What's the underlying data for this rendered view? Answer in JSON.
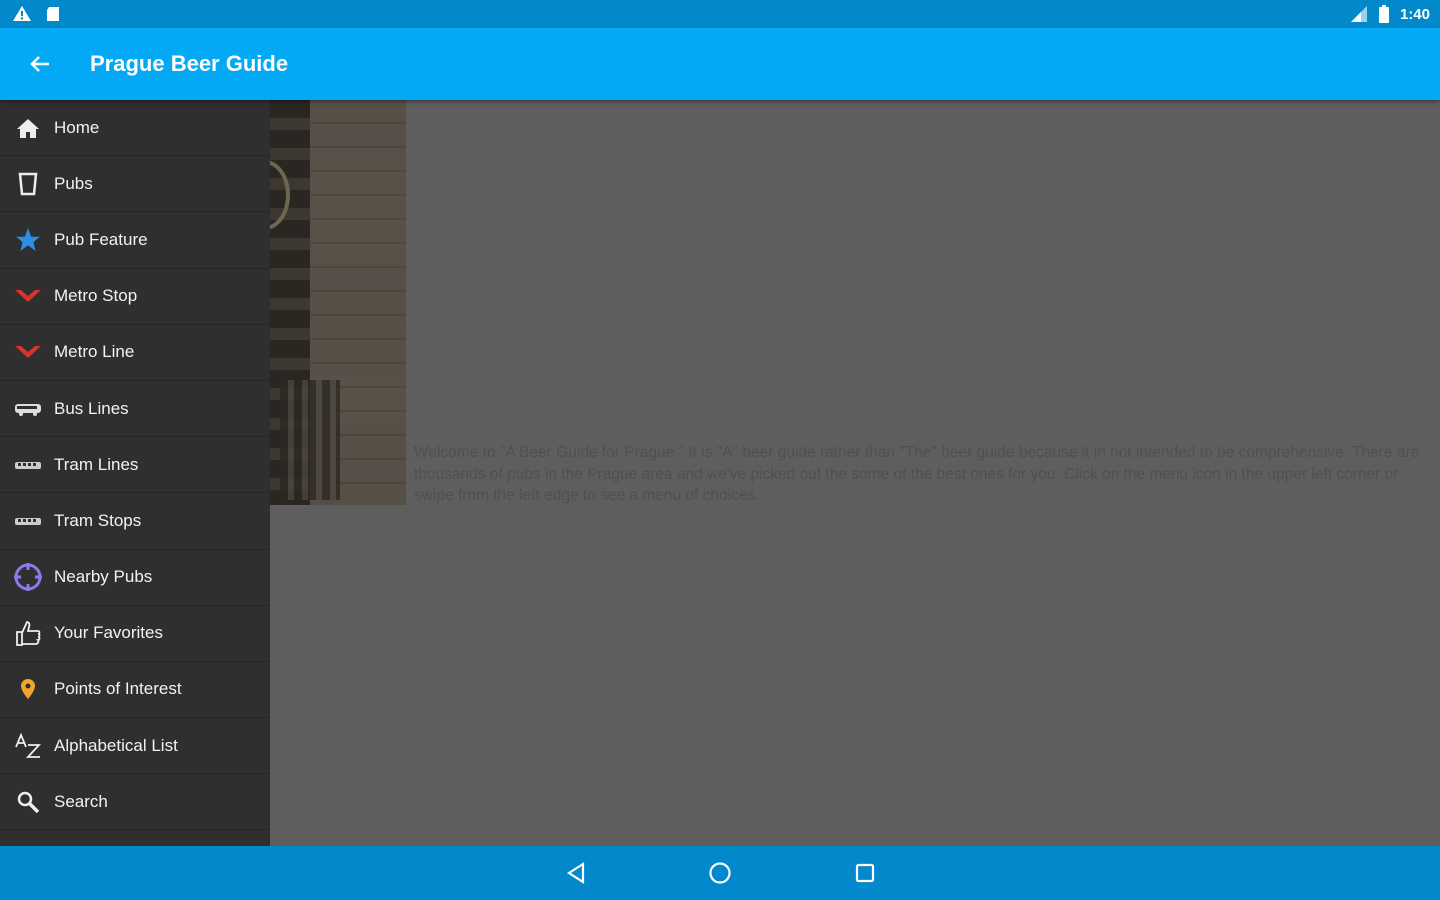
{
  "status_bar": {
    "time": "1:40",
    "icons": [
      "warning-icon",
      "sd-card-icon",
      "signal-icon",
      "battery-icon"
    ]
  },
  "app_bar": {
    "title": "Prague Beer Guide",
    "back_icon": "arrow-left-icon",
    "color": "#03a9f4"
  },
  "drawer": {
    "items": [
      {
        "label": "Home",
        "icon": "home-icon"
      },
      {
        "label": "Pubs",
        "icon": "beer-glass-icon"
      },
      {
        "label": "Pub Feature",
        "icon": "star-icon"
      },
      {
        "label": "Metro Stop",
        "icon": "metro-stop-icon"
      },
      {
        "label": "Metro Line",
        "icon": "metro-line-icon"
      },
      {
        "label": "Bus Lines",
        "icon": "bus-icon"
      },
      {
        "label": "Tram Lines",
        "icon": "tram-icon"
      },
      {
        "label": "Tram Stops",
        "icon": "tram-stop-icon"
      },
      {
        "label": "Nearby Pubs",
        "icon": "crosshair-icon"
      },
      {
        "label": "Your Favorites",
        "icon": "thumbs-up-icon"
      },
      {
        "label": "Points of Interest",
        "icon": "map-pin-icon"
      },
      {
        "label": "Alphabetical List",
        "icon": "a-to-z-icon"
      },
      {
        "label": "Search",
        "icon": "search-icon"
      }
    ]
  },
  "main": {
    "welcome_text": "Welcome to \"A Beer Guide for Prague.\" It is \"A\" beer guide rather than \"The\" beer guide because it in not intended to be comprehensive. There are thousands of pubs in the Prague area and we've picked out the some of the best ones for you. Click on the menu icon in the upper left corner or swipe from the left edge to see a menu of choices."
  },
  "nav_bar": {
    "buttons": [
      "back-triangle-icon",
      "home-circle-icon",
      "recents-square-icon"
    ]
  }
}
